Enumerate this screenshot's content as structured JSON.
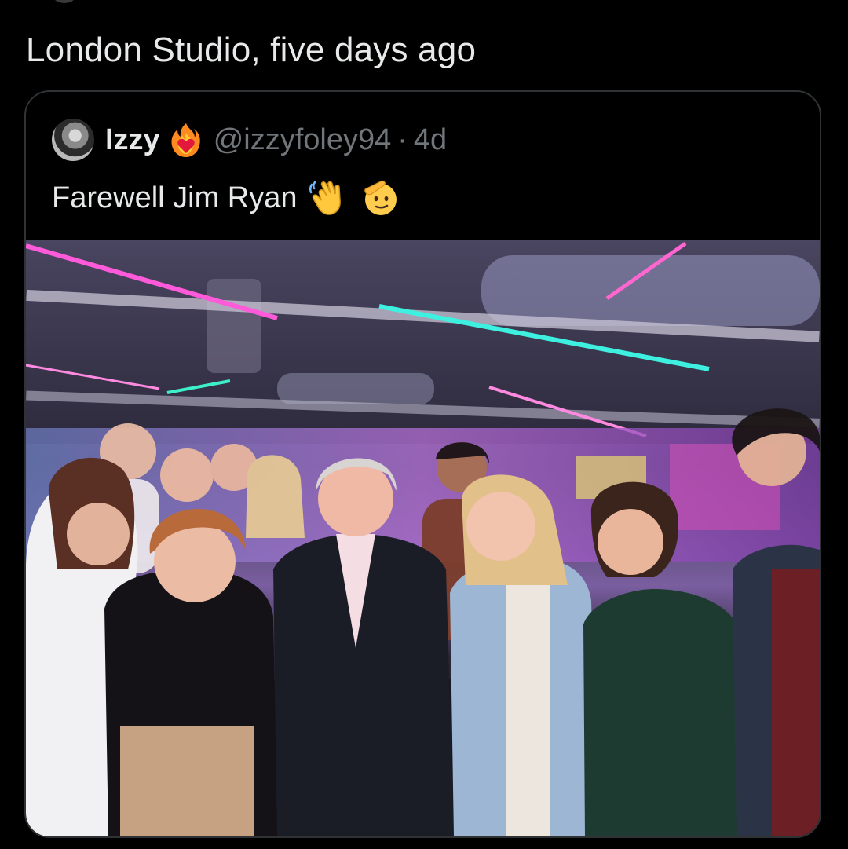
{
  "tweet": {
    "text": "London Studio, five days ago"
  },
  "quoted_tweet": {
    "display_name": "Izzy",
    "name_emoji_icon": "heart-on-fire-icon",
    "handle": "@izzyfoley94",
    "separator": "·",
    "time": "4d",
    "text": "Farewell Jim Ryan",
    "text_emoji_icons": [
      "waving-hand-icon",
      "saluting-face-icon"
    ]
  },
  "photo": {
    "content": "group-photo"
  },
  "colors": {
    "background": "#000000",
    "primary_text": "#e7e9ea",
    "secondary_text": "#71767b",
    "card_border": "#2f3336"
  }
}
